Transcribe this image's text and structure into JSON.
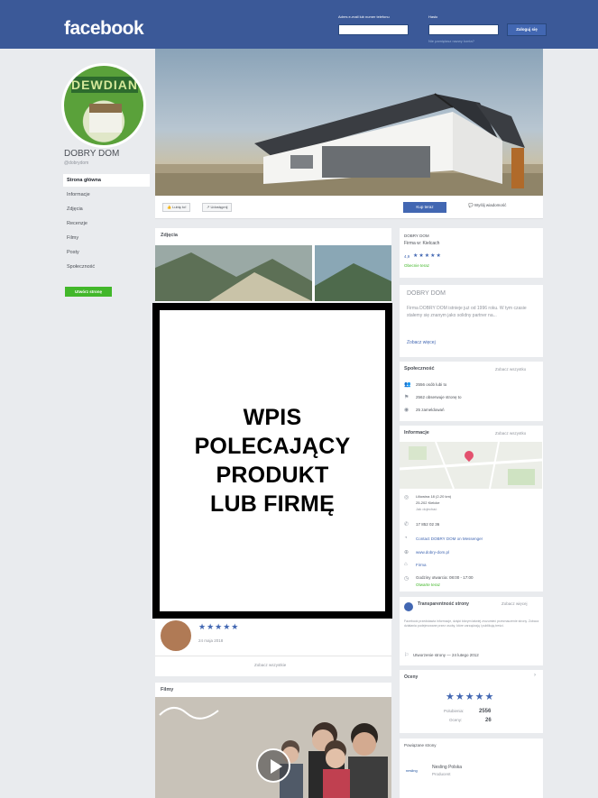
{
  "topbar": {
    "logo": "facebook",
    "email_label": "Adres e-mail lub numer telefonu",
    "password_label": "Hasło",
    "forgot": "Nie pamiętasz nazwy konta?",
    "login": "Zaloguj się"
  },
  "profile": {
    "masthead": "DEWDIAN",
    "name": "DOBRY DOM",
    "handle": "@dobrydom"
  },
  "nav": {
    "items": [
      "Strona główna",
      "Informacje",
      "Zdjęcia",
      "Recenzje",
      "Filmy",
      "Posty",
      "Społeczność"
    ],
    "create_page": "Utwórz stronę"
  },
  "actions": {
    "like": "Lubię to!",
    "share": "Udostępnij",
    "buy": "Kup teraz",
    "message": "Wyślij wiadomość"
  },
  "photos": {
    "title": "Zdjęcia"
  },
  "overlay": {
    "line1": "WPIS",
    "line2": "POLECAJĄCY",
    "line3": "PRODUKT",
    "line4": "LUB FIRMĘ"
  },
  "review": {
    "stars": "★★★★★",
    "date": "24 maja 2018",
    "see_all": "Zobacz wszystkie"
  },
  "films": {
    "title": "Filmy"
  },
  "about_card": {
    "name": "DOBRY DOM",
    "category": "Firma w: Kielcach",
    "rating": "4,9",
    "stars": "★★★★★",
    "status": "Obecnie teraz"
  },
  "desc_card": {
    "title": "DOBRY DOM",
    "text": "Firma DOBRY DOM istnieje już od 1996 roku. W tym czasie stałemy się znanym jako solidny partner na...",
    "more": "Zobacz więcej"
  },
  "community": {
    "title": "Społeczność",
    "see_all": "Zobacz wszystko",
    "items": [
      "2556 osób lubi to",
      "2562 obserwuje stronę to",
      "25 zameldowań"
    ]
  },
  "info": {
    "title": "Informacje",
    "see_all": "Zobacz wszystko",
    "address": [
      "Liliowina 18 (2-20 km)",
      "25-202 Kielcke",
      "Jak dojechać"
    ],
    "phone": "17 852 02 36",
    "contact": "Contact DOBRY DOM on Messenger",
    "website": "www.dobry-dom.pl",
    "category": "Firma",
    "hours": "Godziny otwarcia: 08:00 - 17:00",
    "hours_status": "Otwarte teraz"
  },
  "transparency": {
    "title": "Transparentność strony",
    "see_more": "Zobacz więcej",
    "text": "Facebook przedstawia informacje, dzięki którym łatwiej zrozumieć przeznaczenie strony. Zobacz działania podejmowane przez osoby, które zarządzają i publikują treści.",
    "created": "Utworzenie strony — 24 lutego 2012"
  },
  "ratings": {
    "title": "Oceny",
    "stars": "★★★★★",
    "count_label": "Polubienia:",
    "count": "2556",
    "score_label": "Oceny:",
    "score": "26"
  },
  "related": {
    "title": "Powiązane strony",
    "item_name": "Nesling Polska",
    "item_cat": "Producent",
    "item_logo": "nesling"
  },
  "colors": {
    "brand": "#3b5998",
    "accent": "#4267b2",
    "green": "#42b72a"
  }
}
